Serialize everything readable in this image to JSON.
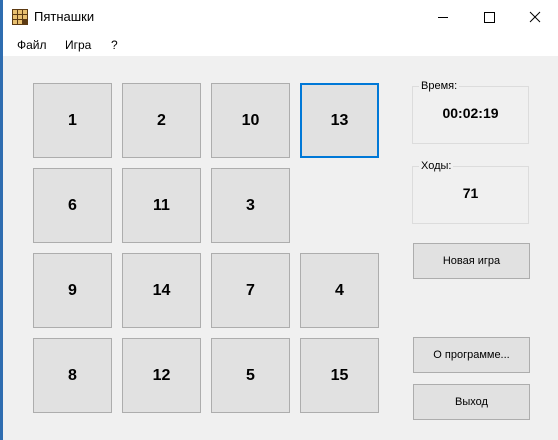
{
  "window": {
    "title": "Пятнашки",
    "icon": "tile-puzzle-icon"
  },
  "menu": {
    "items": [
      "Файл",
      "Игра",
      "?"
    ]
  },
  "board": {
    "tiles": [
      {
        "label": "1"
      },
      {
        "label": "2"
      },
      {
        "label": "10"
      },
      {
        "label": "13"
      },
      {
        "label": "6"
      },
      {
        "label": "11"
      },
      {
        "label": "3"
      },
      {
        "label": ""
      },
      {
        "label": "9"
      },
      {
        "label": "14"
      },
      {
        "label": "7"
      },
      {
        "label": "4"
      },
      {
        "label": "8"
      },
      {
        "label": "12"
      },
      {
        "label": "5"
      },
      {
        "label": "15"
      }
    ],
    "focused_tile": "13"
  },
  "time": {
    "label": "Время:",
    "value": "00:02:19"
  },
  "moves": {
    "label": "Ходы:",
    "value": "71"
  },
  "buttons": {
    "new_game": "Новая игра",
    "about": "О программе...",
    "exit": "Выход"
  },
  "colors": {
    "accent": "#0078d7",
    "tile_bg": "#e1e1e1",
    "window_bg": "#f0f0f0"
  }
}
